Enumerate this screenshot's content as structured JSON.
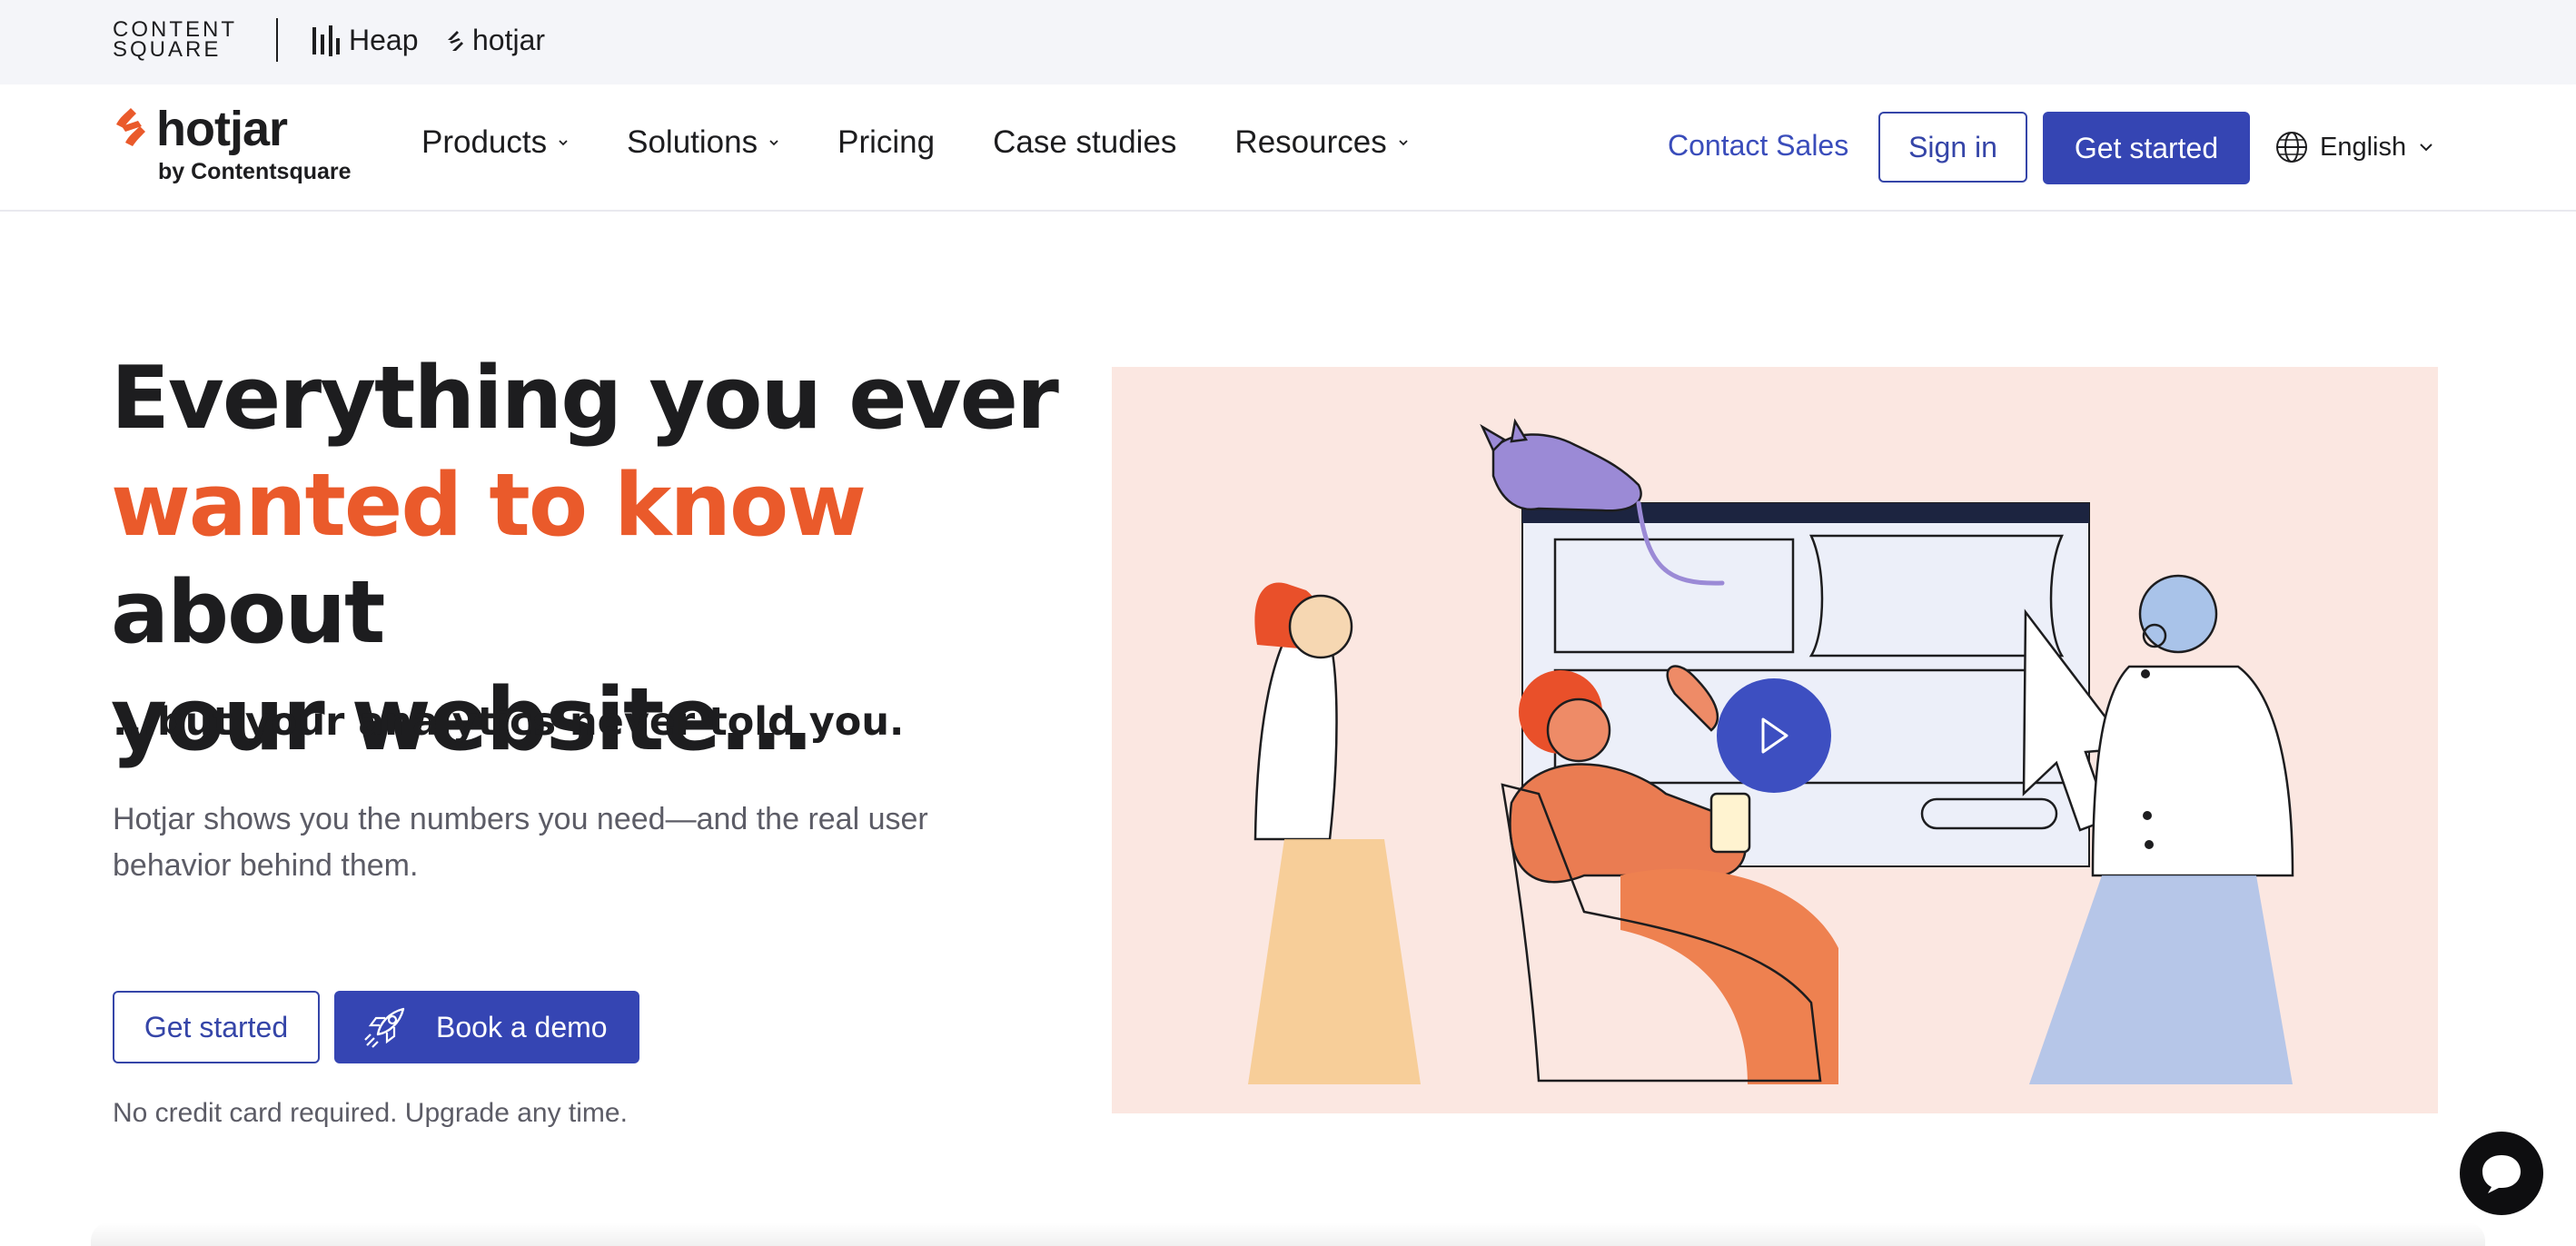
{
  "brand_bar": {
    "contentsquare": "CONTENT\nSQUARE",
    "heap": "Heap",
    "hotjar": "hotjar"
  },
  "nav": {
    "logo_word": "hotjar",
    "logo_sub": "by Contentsquare",
    "menu": [
      {
        "label": "Products",
        "dropdown": true
      },
      {
        "label": "Solutions",
        "dropdown": true
      },
      {
        "label": "Pricing",
        "dropdown": false
      },
      {
        "label": "Case studies",
        "dropdown": false
      },
      {
        "label": "Resources",
        "dropdown": true
      }
    ],
    "contact": "Contact Sales",
    "sign_in": "Sign in",
    "get_started": "Get started",
    "language": "English"
  },
  "hero": {
    "headline_1": "Everything you ever",
    "headline_highlight": "wanted to know",
    "headline_2": "about",
    "headline_3": "your website...",
    "subhead": "...but your analytics never told you.",
    "description": "Hotjar shows you the numbers you need—and the real user behavior behind them.",
    "cta_primary": "Get started",
    "cta_demo": "Book a demo",
    "note": "No credit card required. Upgrade any time."
  },
  "colors": {
    "accent": "#3545b3",
    "brand_orange": "#ea5a2b",
    "illustration_bg": "#fbe7e1",
    "brand_bar_bg": "#f4f5f9"
  },
  "icons": {
    "play": "play-icon",
    "chat": "chat-bubble-icon",
    "globe": "globe-icon",
    "rocket": "rocket-icon"
  }
}
